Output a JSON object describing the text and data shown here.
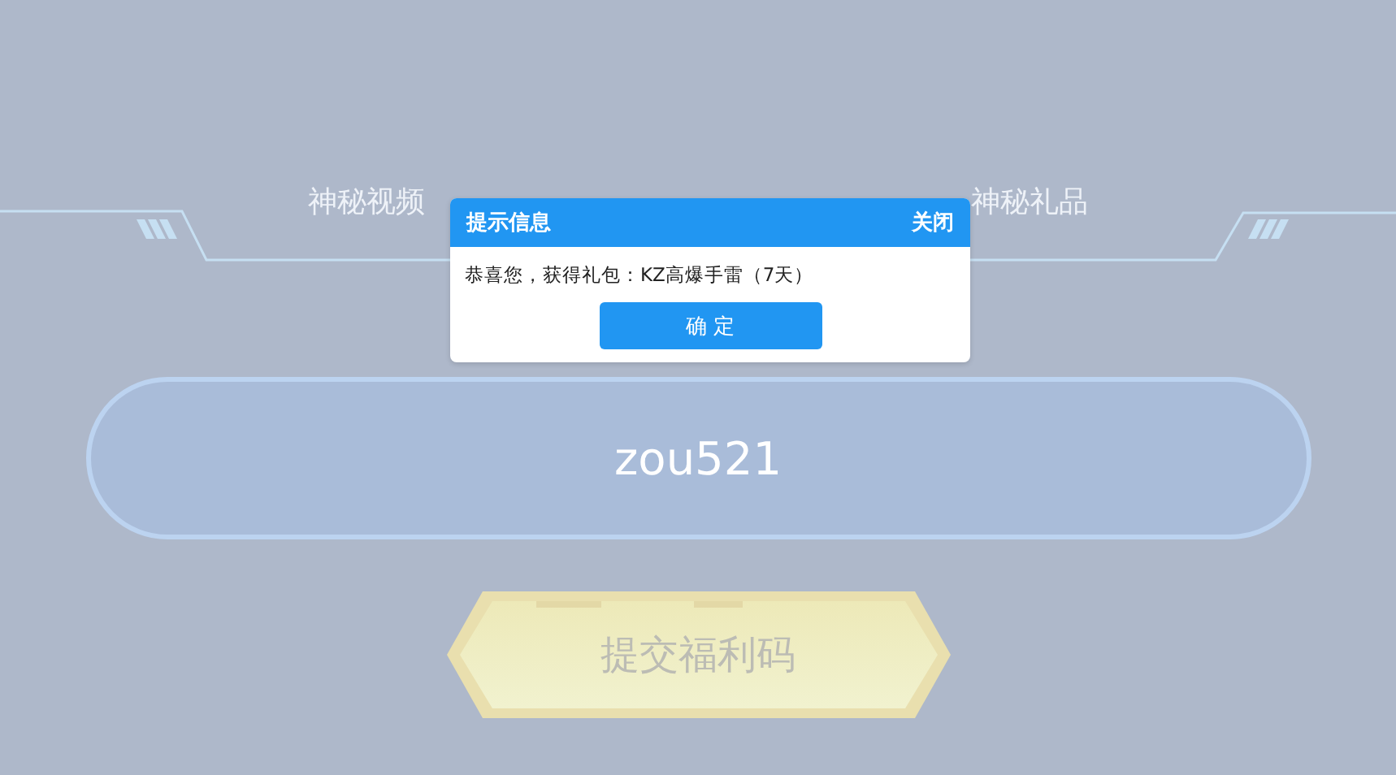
{
  "page": {
    "subtitle_left": "神秘视频",
    "subtitle_right": "神秘礼品",
    "code_field": {
      "value": "zou521"
    },
    "submit_button": {
      "label": "提交福利码",
      "disabled": true
    }
  },
  "dialog": {
    "title": "提示信息",
    "close": "关闭",
    "message": "恭喜您，获得礼包：KZ高爆手雷（7天）",
    "confirm": "确 定"
  }
}
